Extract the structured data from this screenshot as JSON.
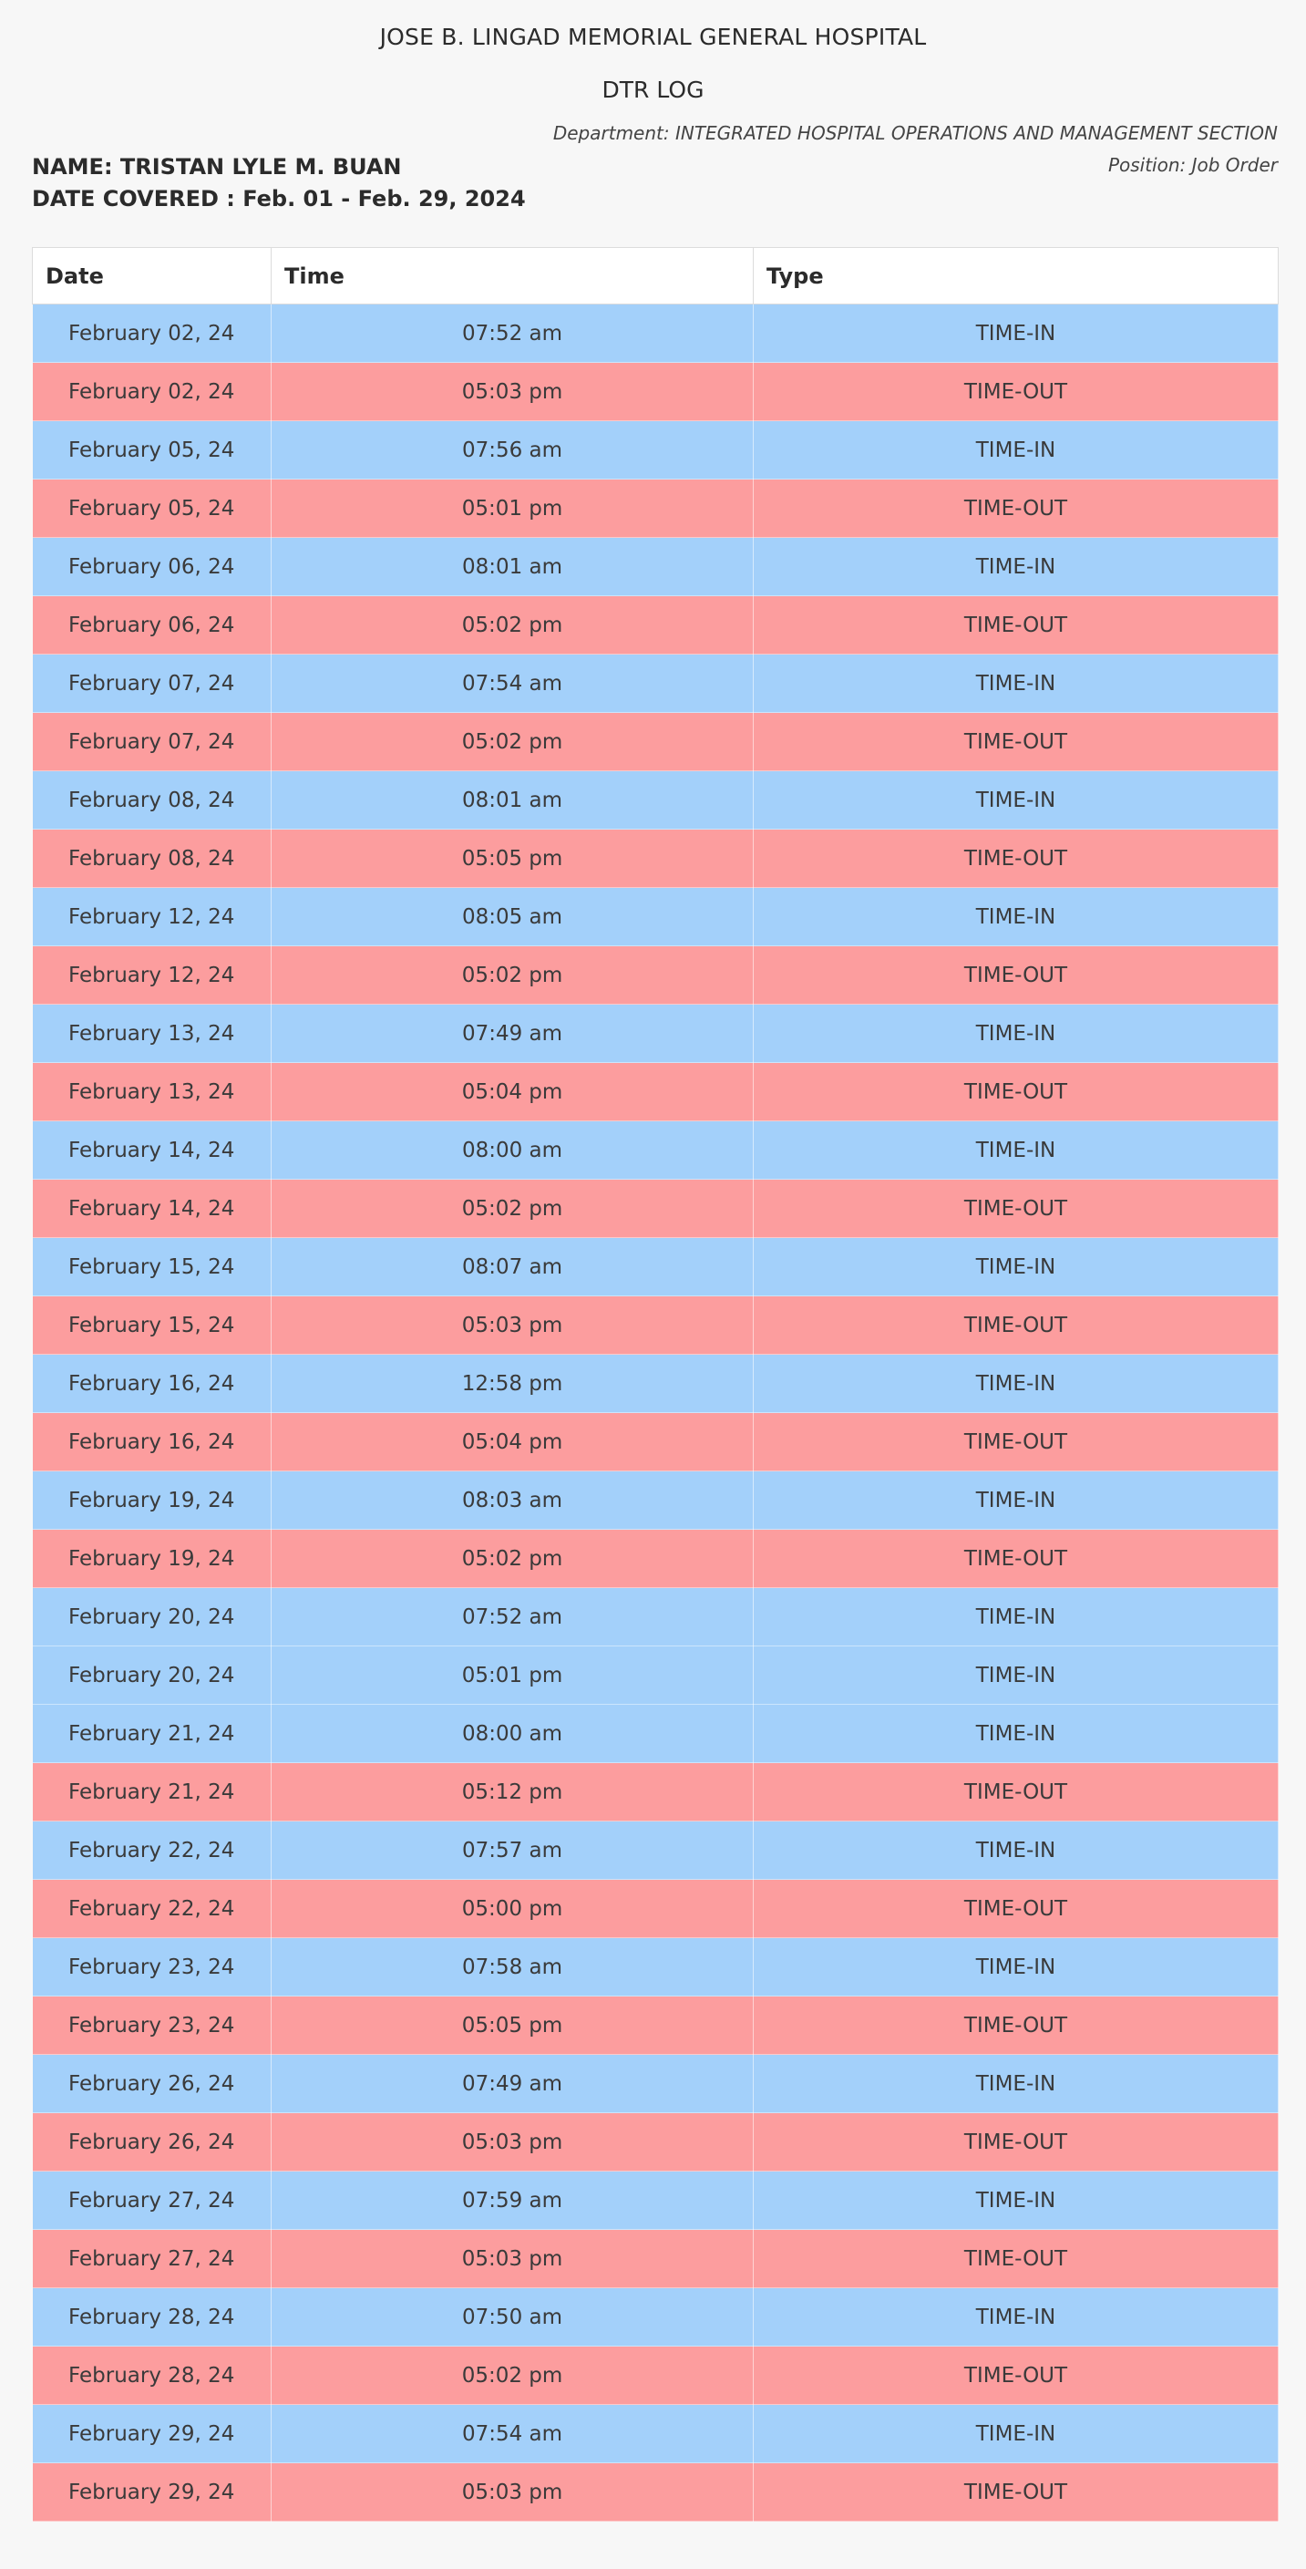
{
  "header": {
    "hospital": "JOSE B. LINGAD MEMORIAL GENERAL HOSPITAL",
    "log_title": "DTR LOG",
    "department": "Department: INTEGRATED HOSPITAL OPERATIONS AND MANAGEMENT SECTION",
    "position": "Position: Job Order",
    "name": "NAME: TRISTAN LYLE M. BUAN",
    "date_covered": "DATE COVERED : Feb. 01 - Feb. 29, 2024"
  },
  "colors": {
    "time_in_row": "#a3d0fa",
    "time_out_row": "#fc9d9e"
  },
  "table": {
    "columns": [
      "Date",
      "Time",
      "Type"
    ],
    "rows": [
      {
        "date": "February 02, 24",
        "time": "07:52 am",
        "type": "TIME-IN"
      },
      {
        "date": "February 02, 24",
        "time": "05:03 pm",
        "type": "TIME-OUT"
      },
      {
        "date": "February 05, 24",
        "time": "07:56 am",
        "type": "TIME-IN"
      },
      {
        "date": "February 05, 24",
        "time": "05:01 pm",
        "type": "TIME-OUT"
      },
      {
        "date": "February 06, 24",
        "time": "08:01 am",
        "type": "TIME-IN"
      },
      {
        "date": "February 06, 24",
        "time": "05:02 pm",
        "type": "TIME-OUT"
      },
      {
        "date": "February 07, 24",
        "time": "07:54 am",
        "type": "TIME-IN"
      },
      {
        "date": "February 07, 24",
        "time": "05:02 pm",
        "type": "TIME-OUT"
      },
      {
        "date": "February 08, 24",
        "time": "08:01 am",
        "type": "TIME-IN"
      },
      {
        "date": "February 08, 24",
        "time": "05:05 pm",
        "type": "TIME-OUT"
      },
      {
        "date": "February 12, 24",
        "time": "08:05 am",
        "type": "TIME-IN"
      },
      {
        "date": "February 12, 24",
        "time": "05:02 pm",
        "type": "TIME-OUT"
      },
      {
        "date": "February 13, 24",
        "time": "07:49 am",
        "type": "TIME-IN"
      },
      {
        "date": "February 13, 24",
        "time": "05:04 pm",
        "type": "TIME-OUT"
      },
      {
        "date": "February 14, 24",
        "time": "08:00 am",
        "type": "TIME-IN"
      },
      {
        "date": "February 14, 24",
        "time": "05:02 pm",
        "type": "TIME-OUT"
      },
      {
        "date": "February 15, 24",
        "time": "08:07 am",
        "type": "TIME-IN"
      },
      {
        "date": "February 15, 24",
        "time": "05:03 pm",
        "type": "TIME-OUT"
      },
      {
        "date": "February 16, 24",
        "time": "12:58 pm",
        "type": "TIME-IN"
      },
      {
        "date": "February 16, 24",
        "time": "05:04 pm",
        "type": "TIME-OUT"
      },
      {
        "date": "February 19, 24",
        "time": "08:03 am",
        "type": "TIME-IN"
      },
      {
        "date": "February 19, 24",
        "time": "05:02 pm",
        "type": "TIME-OUT"
      },
      {
        "date": "February 20, 24",
        "time": "07:52 am",
        "type": "TIME-IN"
      },
      {
        "date": "February 20, 24",
        "time": "05:01 pm",
        "type": "TIME-IN"
      },
      {
        "date": "February 21, 24",
        "time": "08:00 am",
        "type": "TIME-IN"
      },
      {
        "date": "February 21, 24",
        "time": "05:12 pm",
        "type": "TIME-OUT"
      },
      {
        "date": "February 22, 24",
        "time": "07:57 am",
        "type": "TIME-IN"
      },
      {
        "date": "February 22, 24",
        "time": "05:00 pm",
        "type": "TIME-OUT"
      },
      {
        "date": "February 23, 24",
        "time": "07:58 am",
        "type": "TIME-IN"
      },
      {
        "date": "February 23, 24",
        "time": "05:05 pm",
        "type": "TIME-OUT"
      },
      {
        "date": "February 26, 24",
        "time": "07:49 am",
        "type": "TIME-IN"
      },
      {
        "date": "February 26, 24",
        "time": "05:03 pm",
        "type": "TIME-OUT"
      },
      {
        "date": "February 27, 24",
        "time": "07:59 am",
        "type": "TIME-IN"
      },
      {
        "date": "February 27, 24",
        "time": "05:03 pm",
        "type": "TIME-OUT"
      },
      {
        "date": "February 28, 24",
        "time": "07:50 am",
        "type": "TIME-IN"
      },
      {
        "date": "February 28, 24",
        "time": "05:02 pm",
        "type": "TIME-OUT"
      },
      {
        "date": "February 29, 24",
        "time": "07:54 am",
        "type": "TIME-IN"
      },
      {
        "date": "February 29, 24",
        "time": "05:03 pm",
        "type": "TIME-OUT"
      }
    ]
  }
}
